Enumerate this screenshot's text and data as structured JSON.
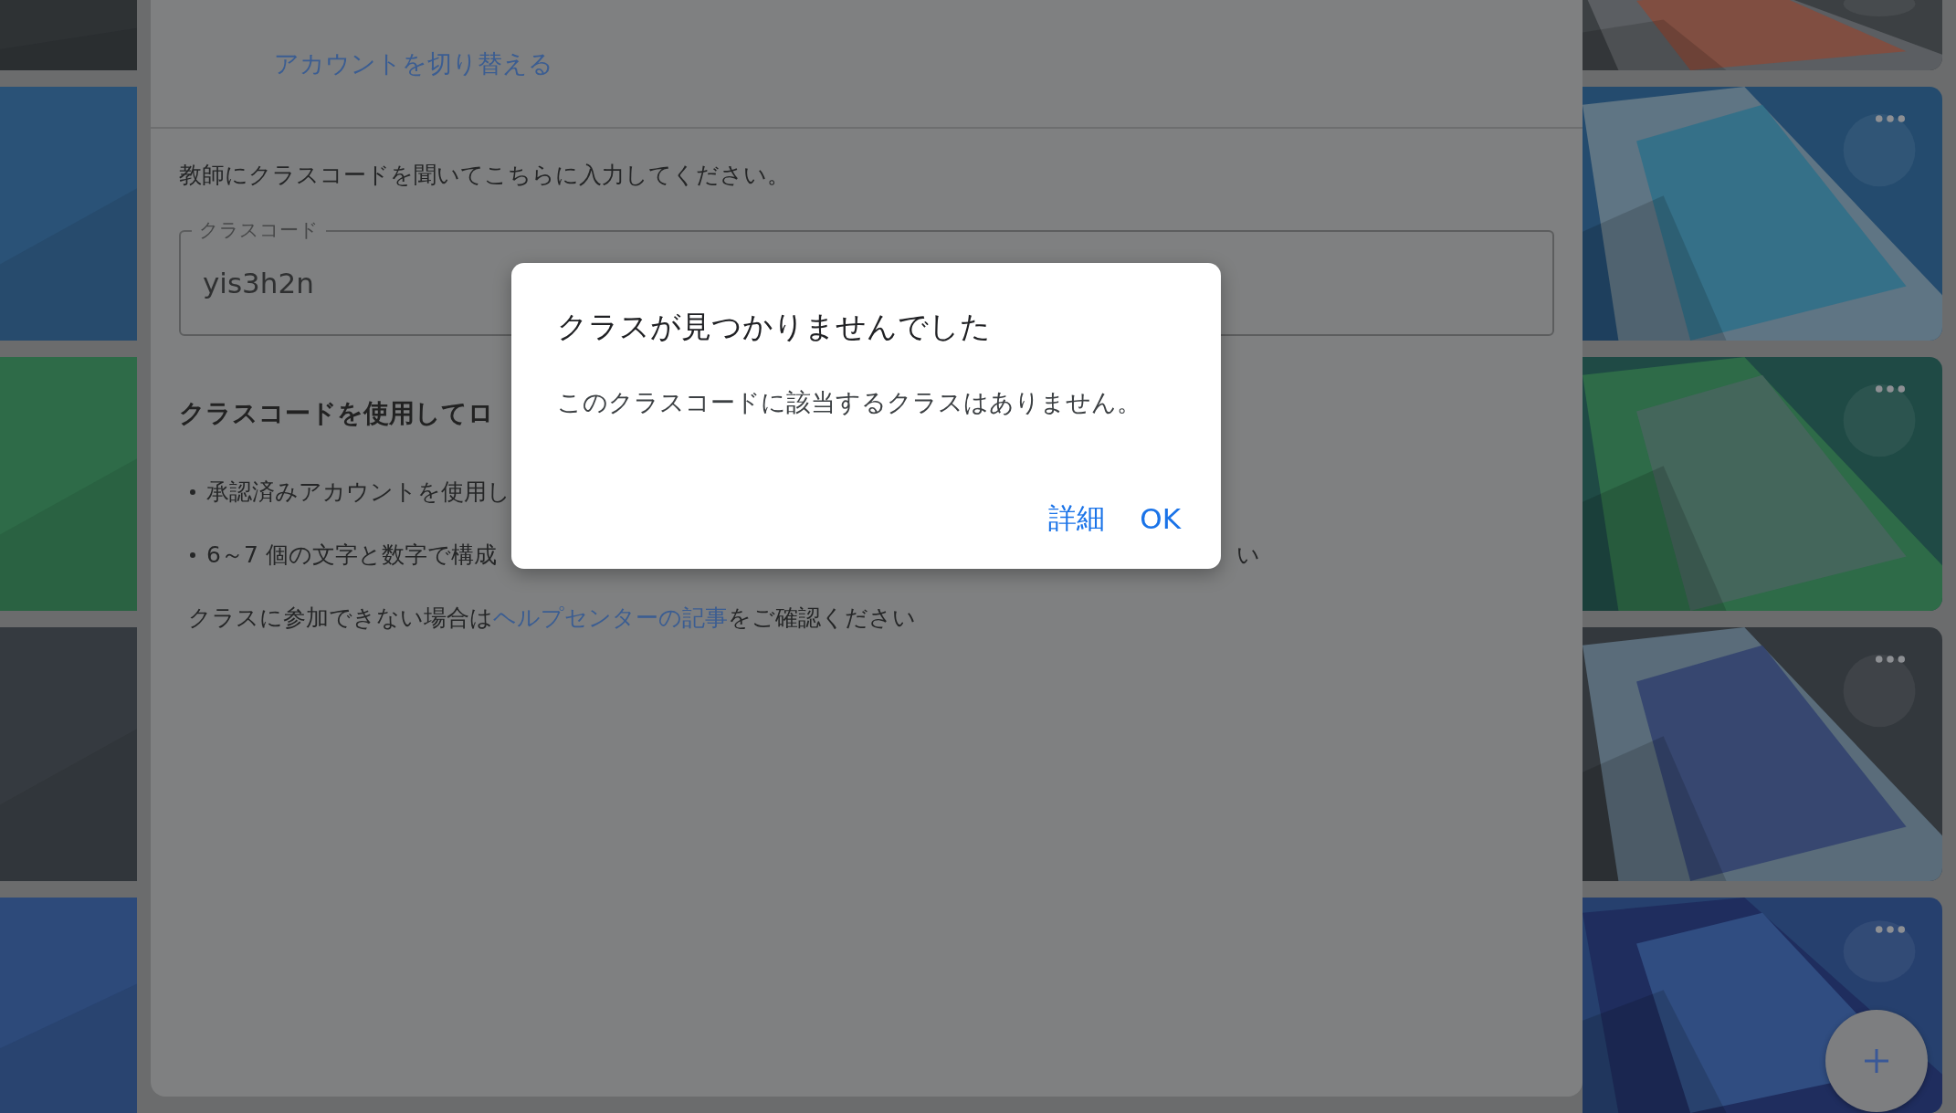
{
  "account_link": "アカウントを切り替える",
  "instruction": "教師にクラスコードを聞いてこちらに入力してください。",
  "class_code_field": {
    "label": "クラスコード",
    "value": "yis3h2n"
  },
  "section_heading": "クラスコードを使用してロ",
  "bullets": [
    {
      "text": "承認済みアカウントを使用し"
    },
    {
      "text": "6～7 個の文字と数字で構成",
      "tail": "い"
    }
  ],
  "help": {
    "before": "クラスに参加できない場合は",
    "link": "ヘルプセンターの記事",
    "after": "をご確認ください"
  },
  "dialog": {
    "title": "クラスが見つかりませんでした",
    "message": "このクラスコードに該当するクラスはありません。",
    "buttons": [
      "詳細",
      "OK"
    ]
  }
}
